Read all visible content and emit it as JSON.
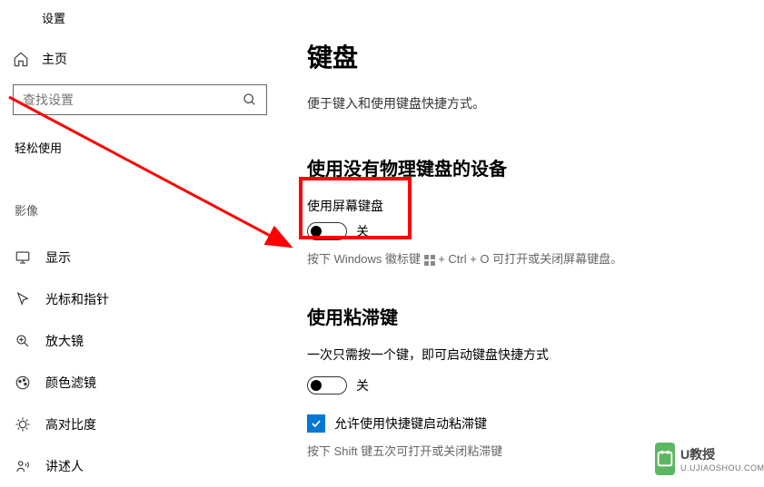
{
  "app": {
    "title": "设置"
  },
  "sidebar": {
    "home_label": "主页",
    "search_placeholder": "查找设置",
    "category_label": "轻松使用",
    "section_label": "影像",
    "items": [
      {
        "label": "显示"
      },
      {
        "label": "光标和指针"
      },
      {
        "label": "放大镜"
      },
      {
        "label": "颜色滤镜"
      },
      {
        "label": "高对比度"
      },
      {
        "label": "讲述人"
      }
    ]
  },
  "main": {
    "page_title": "键盘",
    "intro_text": "便于键入和使用键盘快捷方式。",
    "section1": {
      "heading": "使用没有物理键盘的设备",
      "toggle_label": "使用屏幕键盘",
      "toggle_state": "关",
      "hint_pre": "按下 Windows 徽标键 ",
      "hint_post": " + Ctrl + O 可打开或关闭屏幕键盘。"
    },
    "section2": {
      "heading": "使用粘滞键",
      "desc": "一次只需按一个键，即可启动键盘快捷方式",
      "toggle_state": "关",
      "checkbox_label": "允许使用快捷键启动粘滞键",
      "hint": "按下 Shift 键五次可打开或关闭粘滞键"
    }
  },
  "watermark": {
    "main": "U教授",
    "sub": "U.UJIAOSHOU.COM"
  }
}
